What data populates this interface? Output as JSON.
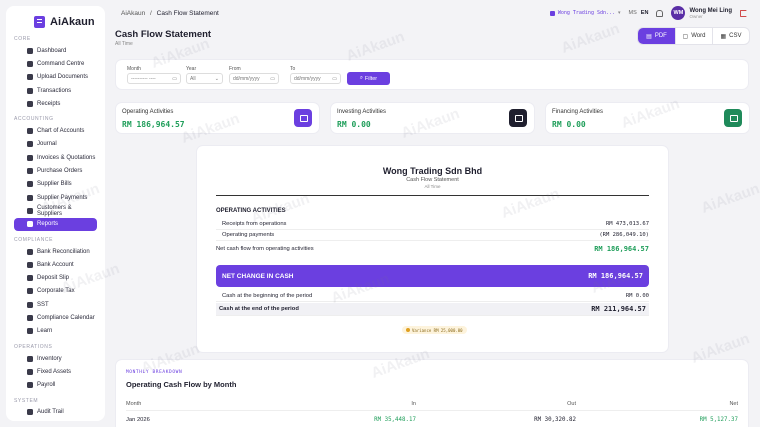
{
  "brand": {
    "name": "AiAkaun"
  },
  "watermark": "AiAkaun",
  "breadcrumb": {
    "root": "AiAkaun",
    "separator": "/",
    "current": "Cash Flow Statement"
  },
  "topbar": {
    "company": "Wong Trading Sdn...",
    "lang_ms": "MS",
    "lang_en": "EN",
    "avatar_initials": "WM",
    "user_name": "Wong Mei Ling",
    "user_role": "Owner"
  },
  "sidebar": {
    "sections": [
      {
        "title": "CORE",
        "items": [
          "Dashboard",
          "Command Centre",
          "Upload Documents",
          "Transactions",
          "Receipts"
        ]
      },
      {
        "title": "ACCOUNTING",
        "items": [
          "Chart of Accounts",
          "Journal",
          "Invoices & Quotations",
          "Purchase Orders",
          "Supplier Bills",
          "Supplier Payments",
          "Customers & Suppliers",
          "Reports"
        ]
      },
      {
        "title": "COMPLIANCE",
        "items": [
          "Bank Reconciliation",
          "Bank Account",
          "Deposit Slip",
          "Corporate Tax",
          "SST",
          "Compliance Calendar",
          "Learn"
        ]
      },
      {
        "title": "OPERATIONS",
        "items": [
          "Inventory",
          "Fixed Assets",
          "Payroll"
        ]
      },
      {
        "title": "SYSTEM",
        "items": [
          "Audit Trail"
        ]
      }
    ],
    "active": "Reports"
  },
  "header": {
    "title": "Cash Flow Statement",
    "subtitle": "All Time"
  },
  "exports": {
    "pdf": "PDF",
    "word": "Word",
    "csv": "CSV"
  },
  "filters": {
    "month_label": "Month",
    "month_value": "---------- ----",
    "year_label": "Year",
    "year_value": "All",
    "from_label": "From",
    "from_value": "dd/mm/yyyy",
    "to_label": "To",
    "to_value": "dd/mm/yyyy",
    "button": "Filter"
  },
  "summary": {
    "operating": {
      "label": "Operating Activities",
      "value": "RM 186,964.57",
      "color": "#6b3fe0"
    },
    "investing": {
      "label": "Investing Activities",
      "value": "RM 0.00",
      "color": "#1f1f2e"
    },
    "financing": {
      "label": "Financing Activities",
      "value": "RM 0.00",
      "color": "#1f8a5a"
    }
  },
  "statement": {
    "company": "Wong Trading Sdn Bhd",
    "title": "Cash Flow Statement",
    "period": "All Time",
    "section": "OPERATING ACTIVITIES",
    "receipts_label": "Receipts from operations",
    "receipts_value": "RM 473,013.67",
    "payments_label": "Operating payments",
    "payments_value": "(RM 286,049.10)",
    "net_label": "Net cash flow from operating activities",
    "net_value": "RM 186,964.57",
    "change_label": "NET CHANGE IN CASH",
    "change_value": "RM 186,964.57",
    "begin_label": "Cash at the beginning of the period",
    "begin_value": "RM 0.00",
    "end_label": "Cash at the end of the period",
    "end_value": "RM 211,964.57",
    "variance": "Variance RM 25,000.00"
  },
  "monthly": {
    "section": "MONTHLY BREAKDOWN",
    "title": "Operating Cash Flow by Month",
    "headers": {
      "month": "Month",
      "in": "In",
      "out": "Out",
      "net": "Net"
    },
    "rows": [
      {
        "month": "Jan 2026",
        "in": "RM 35,448.17",
        "out": "RM 30,320.82",
        "net": "RM 5,127.37"
      }
    ]
  }
}
